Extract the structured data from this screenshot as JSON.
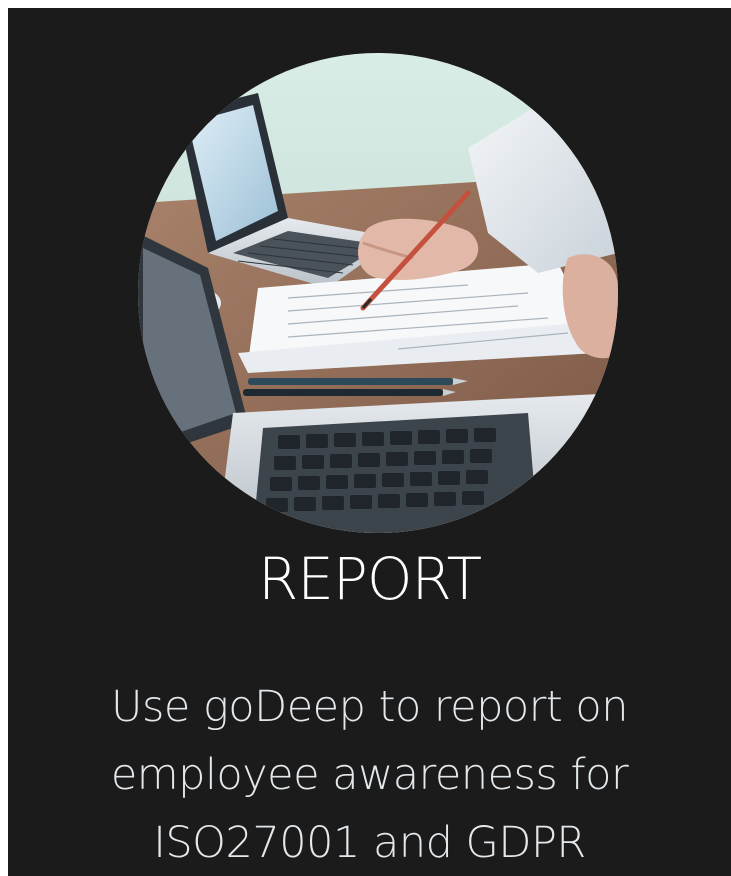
{
  "card": {
    "title": "REPORT",
    "description": "Use goDeep to report on employee awareness for ISO27001 and GDPR",
    "image_subject": "business-meeting-laptops-documents-photo"
  },
  "colors": {
    "card_background": "#1b1b1b",
    "title_text": "#ffffff",
    "description_text": "#e3e8ec"
  }
}
